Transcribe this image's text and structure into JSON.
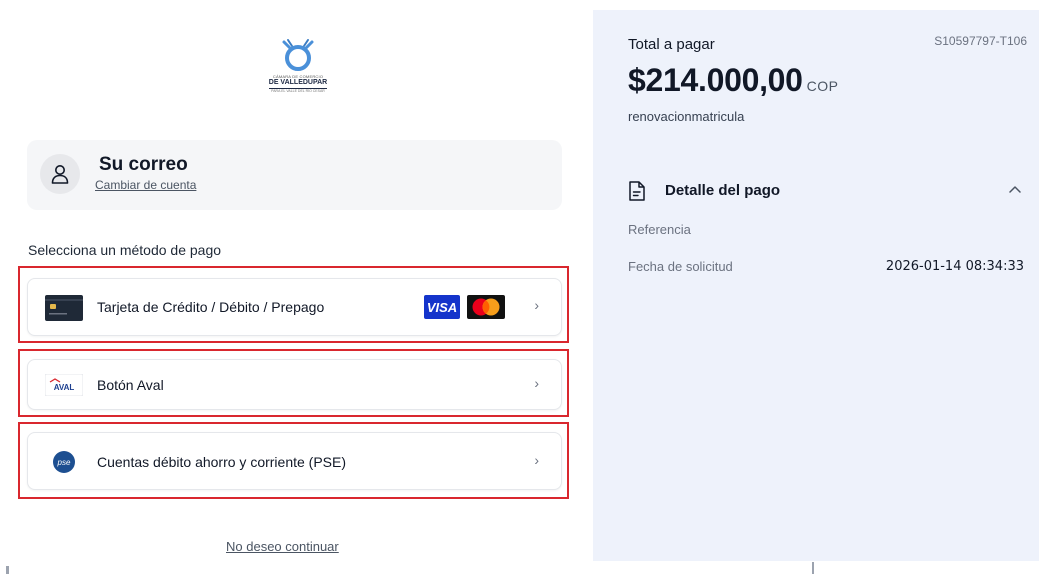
{
  "logo": {
    "line1": "CÁMARA DE COMERCIO",
    "line2": "DE VALLEDUPAR",
    "line3": "PARA EL VALLE DEL RÍO CESAR",
    "icon": "valledupar-logo-icon"
  },
  "account": {
    "name": "Su correo",
    "change_link": "Cambiar de cuenta",
    "icon": "user-icon"
  },
  "methods": {
    "title": "Selecciona un método de pago",
    "items": [
      {
        "label": "Tarjeta de Crédito / Débito / Prepago",
        "icon": "credit-card-icon",
        "badges": [
          "VISA",
          "mastercard"
        ]
      },
      {
        "label": "Botón Aval",
        "icon": "aval-logo-icon",
        "icon_text": "AVAL"
      },
      {
        "label": "Cuentas débito ahorro y corriente (PSE)",
        "icon": "pse-logo-icon",
        "icon_text": "pse"
      }
    ],
    "highlight_color": "#d9272e"
  },
  "footer": {
    "no_continue": "No deseo continuar"
  },
  "summary": {
    "total_label": "Total a pagar",
    "reference_code": "S10597797-T106",
    "amount": "$214.000,00",
    "currency": "COP",
    "concept": "renovacionmatricula",
    "detail": {
      "title": "Detalle del pago",
      "rows": [
        {
          "label": "Referencia",
          "value": ""
        },
        {
          "label": "Fecha de solicitud",
          "value": "2026-01-14 08:34:33"
        }
      ]
    },
    "background": "#eef2fb"
  }
}
